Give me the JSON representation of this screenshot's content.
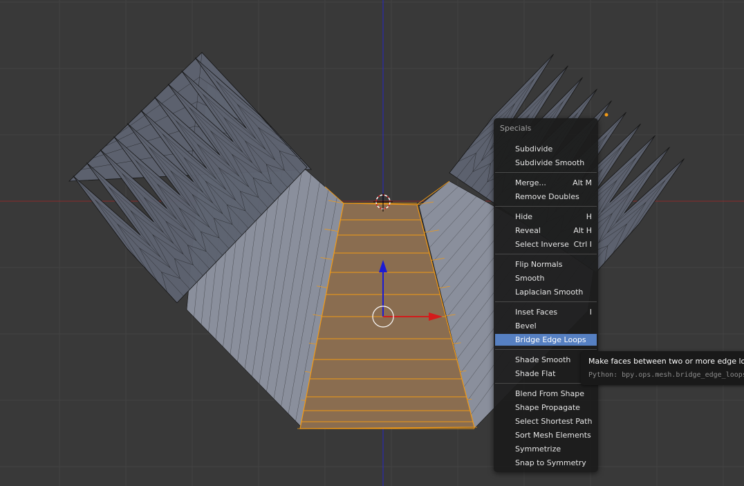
{
  "viewport": {
    "colors": {
      "background": "#393939",
      "grid_line": "#424242",
      "x_axis": "#8c2a2a",
      "z_axis": "#2b2bb0",
      "mesh_face": "#5d6270",
      "mesh_face_light": "#8a8f9c",
      "selected_face": "#8a6d50",
      "selected_edge": "#f29a15",
      "wire": "#141414"
    },
    "manipulator_icons": [
      "cursor-3d-icon",
      "transform-pivot-icon",
      "arrow-up-z-icon",
      "arrow-right-x-icon"
    ]
  },
  "menu": {
    "title": "Specials",
    "items": [
      {
        "label": "Subdivide",
        "shortcut": ""
      },
      {
        "label": "Subdivide Smooth",
        "shortcut": ""
      },
      {
        "label": "Merge...",
        "shortcut": "Alt M"
      },
      {
        "label": "Remove Doubles",
        "shortcut": ""
      },
      {
        "label": "Hide",
        "shortcut": "H"
      },
      {
        "label": "Reveal",
        "shortcut": "Alt H"
      },
      {
        "label": "Select Inverse",
        "shortcut": "Ctrl I"
      },
      {
        "label": "Flip Normals",
        "shortcut": ""
      },
      {
        "label": "Smooth",
        "shortcut": ""
      },
      {
        "label": "Laplacian Smooth",
        "shortcut": ""
      },
      {
        "label": "Inset Faces",
        "shortcut": "I"
      },
      {
        "label": "Bevel",
        "shortcut": ""
      },
      {
        "label": "Bridge Edge Loops",
        "shortcut": "",
        "active": true
      },
      {
        "label": "Shade Smooth",
        "shortcut": ""
      },
      {
        "label": "Shade Flat",
        "shortcut": ""
      },
      {
        "label": "Blend From Shape",
        "shortcut": ""
      },
      {
        "label": "Shape Propagate",
        "shortcut": ""
      },
      {
        "label": "Select Shortest Path",
        "shortcut": ""
      },
      {
        "label": "Sort Mesh Elements",
        "shortcut": ""
      },
      {
        "label": "Symmetrize",
        "shortcut": ""
      },
      {
        "label": "Snap to Symmetry",
        "shortcut": ""
      }
    ],
    "colors": {
      "highlight": "#5680c2",
      "background": "#1c1c1c"
    }
  },
  "tooltip": {
    "title": "Make faces between two or more edge loops:",
    "python": "Python: bpy.ops.mesh.bridge_edge_loops()"
  }
}
